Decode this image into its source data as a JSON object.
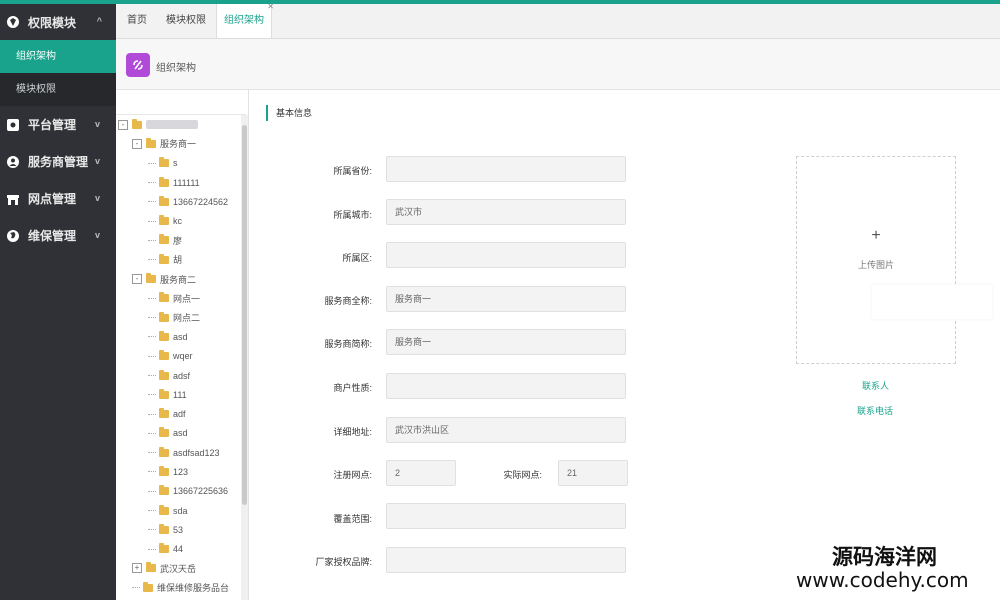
{
  "sidebar": {
    "module_title": "权限模块",
    "sub_items": [
      "组织架构",
      "模块权限"
    ],
    "groups": [
      "平台管理",
      "服务商管理",
      "网点管理",
      "维保管理"
    ]
  },
  "tabs": [
    "首页",
    "模块权限",
    "组织架构"
  ],
  "page": {
    "title": "组织架构"
  },
  "tree": {
    "nodes": [
      {
        "level": 0,
        "toggle": "-",
        "label": "",
        "blurred": true
      },
      {
        "level": 1,
        "toggle": "-",
        "label": "服务商一"
      },
      {
        "level": 2,
        "label": "s"
      },
      {
        "level": 2,
        "label": "111111"
      },
      {
        "level": 2,
        "label": "13667224562"
      },
      {
        "level": 2,
        "label": "kc"
      },
      {
        "level": 2,
        "label": "廖"
      },
      {
        "level": 2,
        "label": "胡"
      },
      {
        "level": 1,
        "toggle": "-",
        "label": "服务商二"
      },
      {
        "level": 2,
        "label": "网点一"
      },
      {
        "level": 2,
        "label": "网点二"
      },
      {
        "level": 2,
        "label": "asd"
      },
      {
        "level": 2,
        "label": "wqer"
      },
      {
        "level": 2,
        "label": "adsf"
      },
      {
        "level": 2,
        "label": "111"
      },
      {
        "level": 2,
        "label": "adf"
      },
      {
        "level": 2,
        "label": "asd"
      },
      {
        "level": 2,
        "label": "asdfsad123"
      },
      {
        "level": 2,
        "label": "123"
      },
      {
        "level": 2,
        "label": "13667225636"
      },
      {
        "level": 2,
        "label": "sda"
      },
      {
        "level": 2,
        "label": "53"
      },
      {
        "level": 2,
        "label": "44"
      },
      {
        "level": 1,
        "toggle": "+",
        "label": "武汉天岳"
      },
      {
        "level": 1,
        "toggle": "",
        "label": "维保维修服务品台"
      }
    ]
  },
  "form": {
    "section_title": "基本信息",
    "province_label": "所属省份:",
    "province_value": "",
    "city_label": "所属城市:",
    "city_value": "武汉市",
    "district_label": "所属区:",
    "district_value": "",
    "fullname_label": "服务商全称:",
    "fullname_value": "服务商一",
    "shortname_label": "服务商简称:",
    "shortname_value": "服务商一",
    "nature_label": "商户性质:",
    "nature_value": "",
    "address_label": "详细地址:",
    "address_value": "武汉市洪山区",
    "registered_label": "注册网点:",
    "registered_value": "2",
    "actual_label": "实际网点:",
    "actual_value": "21",
    "coverage_label": "覆盖范围:",
    "coverage_value": "",
    "brand_label": "厂家授权品牌:",
    "brand_value": ""
  },
  "upload": {
    "plus": "+",
    "text": "上传图片"
  },
  "links": {
    "contact": "联系人",
    "phone": "联系电话"
  },
  "watermark": {
    "line1": "源码海洋网",
    "line2": "www.codehy.com"
  },
  "colors": {
    "accent": "#1aa38c",
    "sidebar": "#2f3136",
    "page_icon": "#b14ad8"
  }
}
